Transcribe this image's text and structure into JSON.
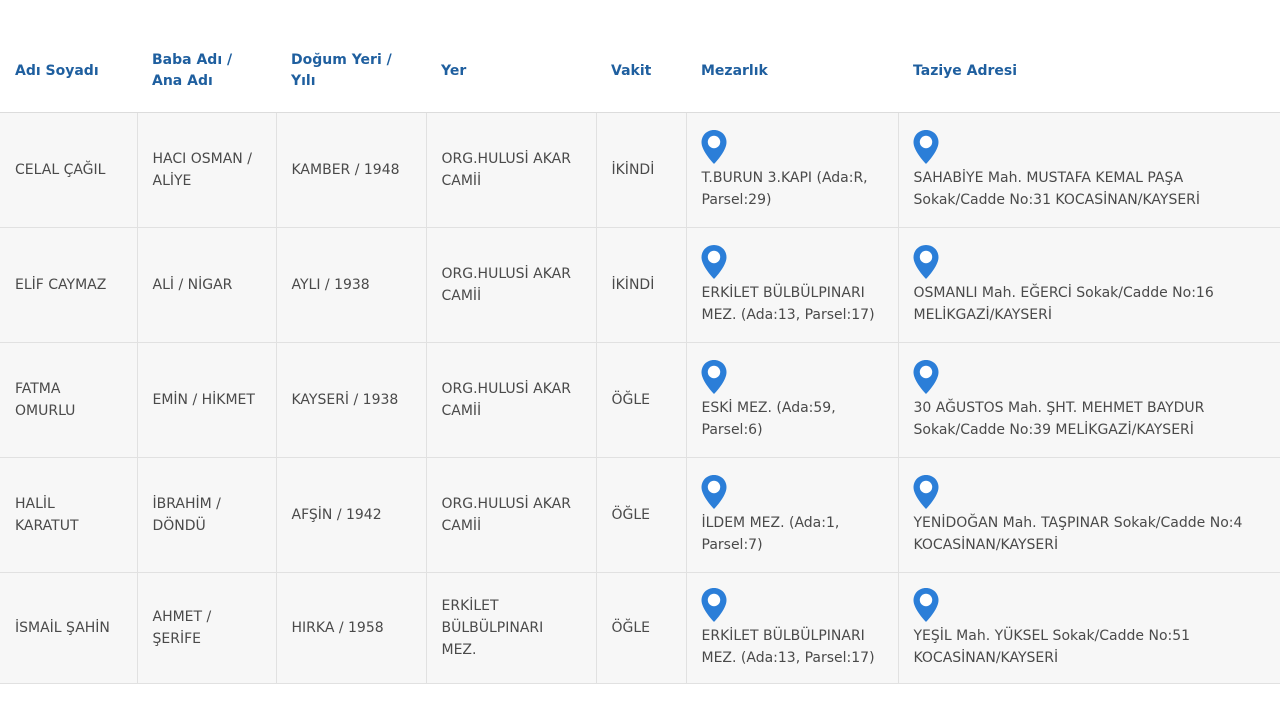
{
  "headers": {
    "name": "Adı Soyadı",
    "parents_line1": "Baba Adı /",
    "parents_line2": "Ana Adı",
    "birth_line1": "Doğum Yeri /",
    "birth_line2": "Yılı",
    "place": "Yer",
    "time": "Vakit",
    "cemetery": "Mezarlık",
    "condolence": "Taziye Adresi"
  },
  "pin_color": "#2b7ed8",
  "header_color": "#1f5f9f",
  "rows": [
    {
      "name": "CELAL ÇAĞIL",
      "parents": "HACI OSMAN / ALİYE",
      "birth": "KAMBER / 1948",
      "place": "ORG.HULUSİ AKAR CAMİİ",
      "time": "İKİNDİ",
      "cemetery": "T.BURUN 3.KAPI (Ada:R, Parsel:29)",
      "condolence": "SAHABİYE Mah. MUSTAFA KEMAL PAŞA Sokak/Cadde No:31 KOCASİNAN/KAYSERİ"
    },
    {
      "name": "ELİF CAYMAZ",
      "parents": "ALİ / NİGAR",
      "birth": "AYLI / 1938",
      "place": "ORG.HULUSİ AKAR CAMİİ",
      "time": "İKİNDİ",
      "cemetery": "ERKİLET BÜLBÜLPINARI MEZ. (Ada:13, Parsel:17)",
      "condolence": "OSMANLI Mah. EĞERCİ Sokak/Cadde No:16 MELİKGAZİ/KAYSERİ"
    },
    {
      "name": "FATMA OMURLU",
      "parents": "EMİN / HİKMET",
      "birth": "KAYSERİ / 1938",
      "place": "ORG.HULUSİ AKAR CAMİİ",
      "time": "ÖĞLE",
      "cemetery": "ESKİ MEZ. (Ada:59, Parsel:6)",
      "condolence": "30 AĞUSTOS Mah. ŞHT. MEHMET BAYDUR Sokak/Cadde No:39 MELİKGAZİ/KAYSERİ"
    },
    {
      "name": "HALİL KARATUT",
      "parents": "İBRAHİM / DÖNDÜ",
      "birth": "AFŞİN / 1942",
      "place": "ORG.HULUSİ AKAR CAMİİ",
      "time": "ÖĞLE",
      "cemetery": "İLDEM MEZ. (Ada:1, Parsel:7)",
      "condolence": "YENİDOĞAN Mah. TAŞPINAR Sokak/Cadde No:4 KOCASİNAN/KAYSERİ"
    },
    {
      "name": "İSMAİL ŞAHİN",
      "parents": "AHMET / ŞERİFE",
      "birth": "HIRKA / 1958",
      "place": "ERKİLET BÜLBÜLPINARI MEZ.",
      "time": "ÖĞLE",
      "cemetery": "ERKİLET BÜLBÜLPINARI MEZ. (Ada:13, Parsel:17)",
      "condolence": "YEŞİL Mah. YÜKSEL Sokak/Cadde No:51 KOCASİNAN/KAYSERİ"
    }
  ]
}
